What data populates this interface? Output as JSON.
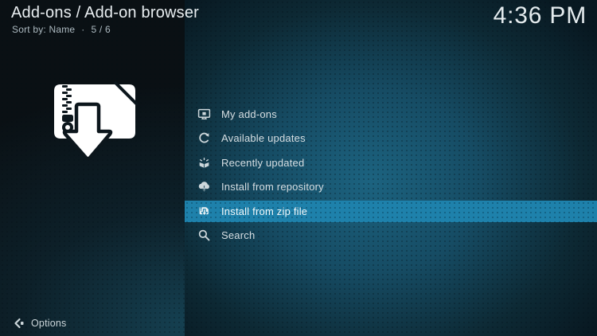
{
  "header": {
    "title": "Add-ons / Add-on browser",
    "sort_by": "Sort by: Name",
    "separator": "·",
    "position": "5 / 6",
    "clock": "4:36 PM"
  },
  "hero": {
    "icon": "zip-file-download-icon"
  },
  "menu": {
    "items": [
      {
        "label": "My add-ons",
        "icon": "my-addons-icon",
        "selected": false
      },
      {
        "label": "Available updates",
        "icon": "available-updates-icon",
        "selected": false
      },
      {
        "label": "Recently updated",
        "icon": "recently-updated-icon",
        "selected": false
      },
      {
        "label": "Install from repository",
        "icon": "install-from-repository-icon",
        "selected": false
      },
      {
        "label": "Install from zip file",
        "icon": "install-from-zip-icon",
        "selected": true
      },
      {
        "label": "Search",
        "icon": "search-icon",
        "selected": false
      }
    ]
  },
  "footer": {
    "options_label": "Options",
    "icon": "options-icon"
  },
  "colors": {
    "highlight": "#1e81ab",
    "panel_glow": "#1c6380",
    "background_dark": "#0a0f13",
    "text_primary": "#e9eef1",
    "text_secondary": "#adbac1",
    "icon_gray": "#cdd7db"
  }
}
